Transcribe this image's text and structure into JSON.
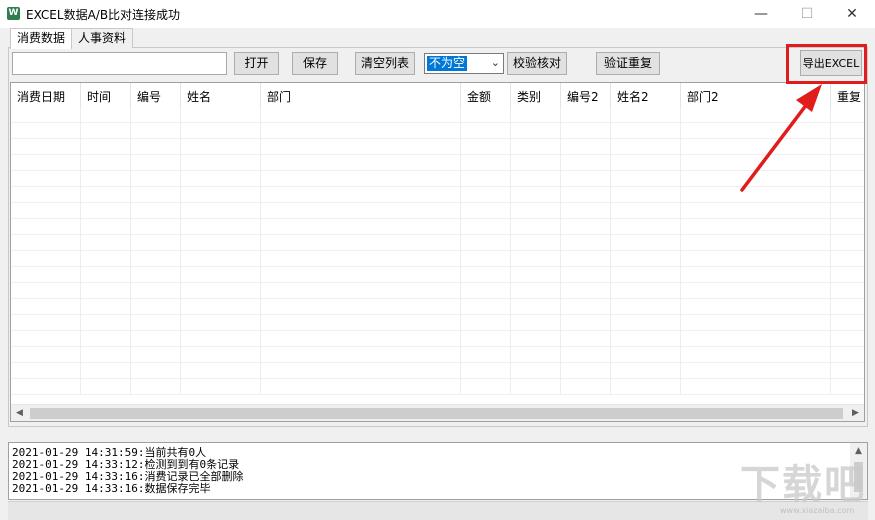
{
  "window": {
    "title": "EXCEL数据A/B比对连接成功",
    "app_icon": "W",
    "minimize": "—",
    "maximize": "☐",
    "close": "✕"
  },
  "tabs": [
    {
      "label": "消费数据",
      "active": true
    },
    {
      "label": "人事资料",
      "active": false
    }
  ],
  "toolbar": {
    "path_input_value": "",
    "open_label": "打开",
    "save_label": "保存",
    "clear_label": "清空列表",
    "filter_value": "不为空",
    "verify_label": "校验核对",
    "dup_label": "验证重复",
    "export_label": "导出EXCEL"
  },
  "grid": {
    "columns": [
      "消费日期",
      "时间",
      "编号",
      "姓名",
      "部门",
      "金额",
      "类别",
      "编号2",
      "姓名2",
      "部门2",
      "重复"
    ],
    "rows": []
  },
  "log": {
    "lines": [
      "2021-01-29 14:31:59:当前共有0人",
      "2021-01-29 14:33:12:检测到到有0条记录",
      "2021-01-29 14:33:16:消费记录已全部删除",
      "2021-01-29 14:33:16:数据保存完毕"
    ]
  },
  "watermark": {
    "text": "下载吧",
    "sub": "www.xiazaiba.com"
  },
  "colors": {
    "highlight": "#e01c1c",
    "selection": "#0078d7"
  }
}
